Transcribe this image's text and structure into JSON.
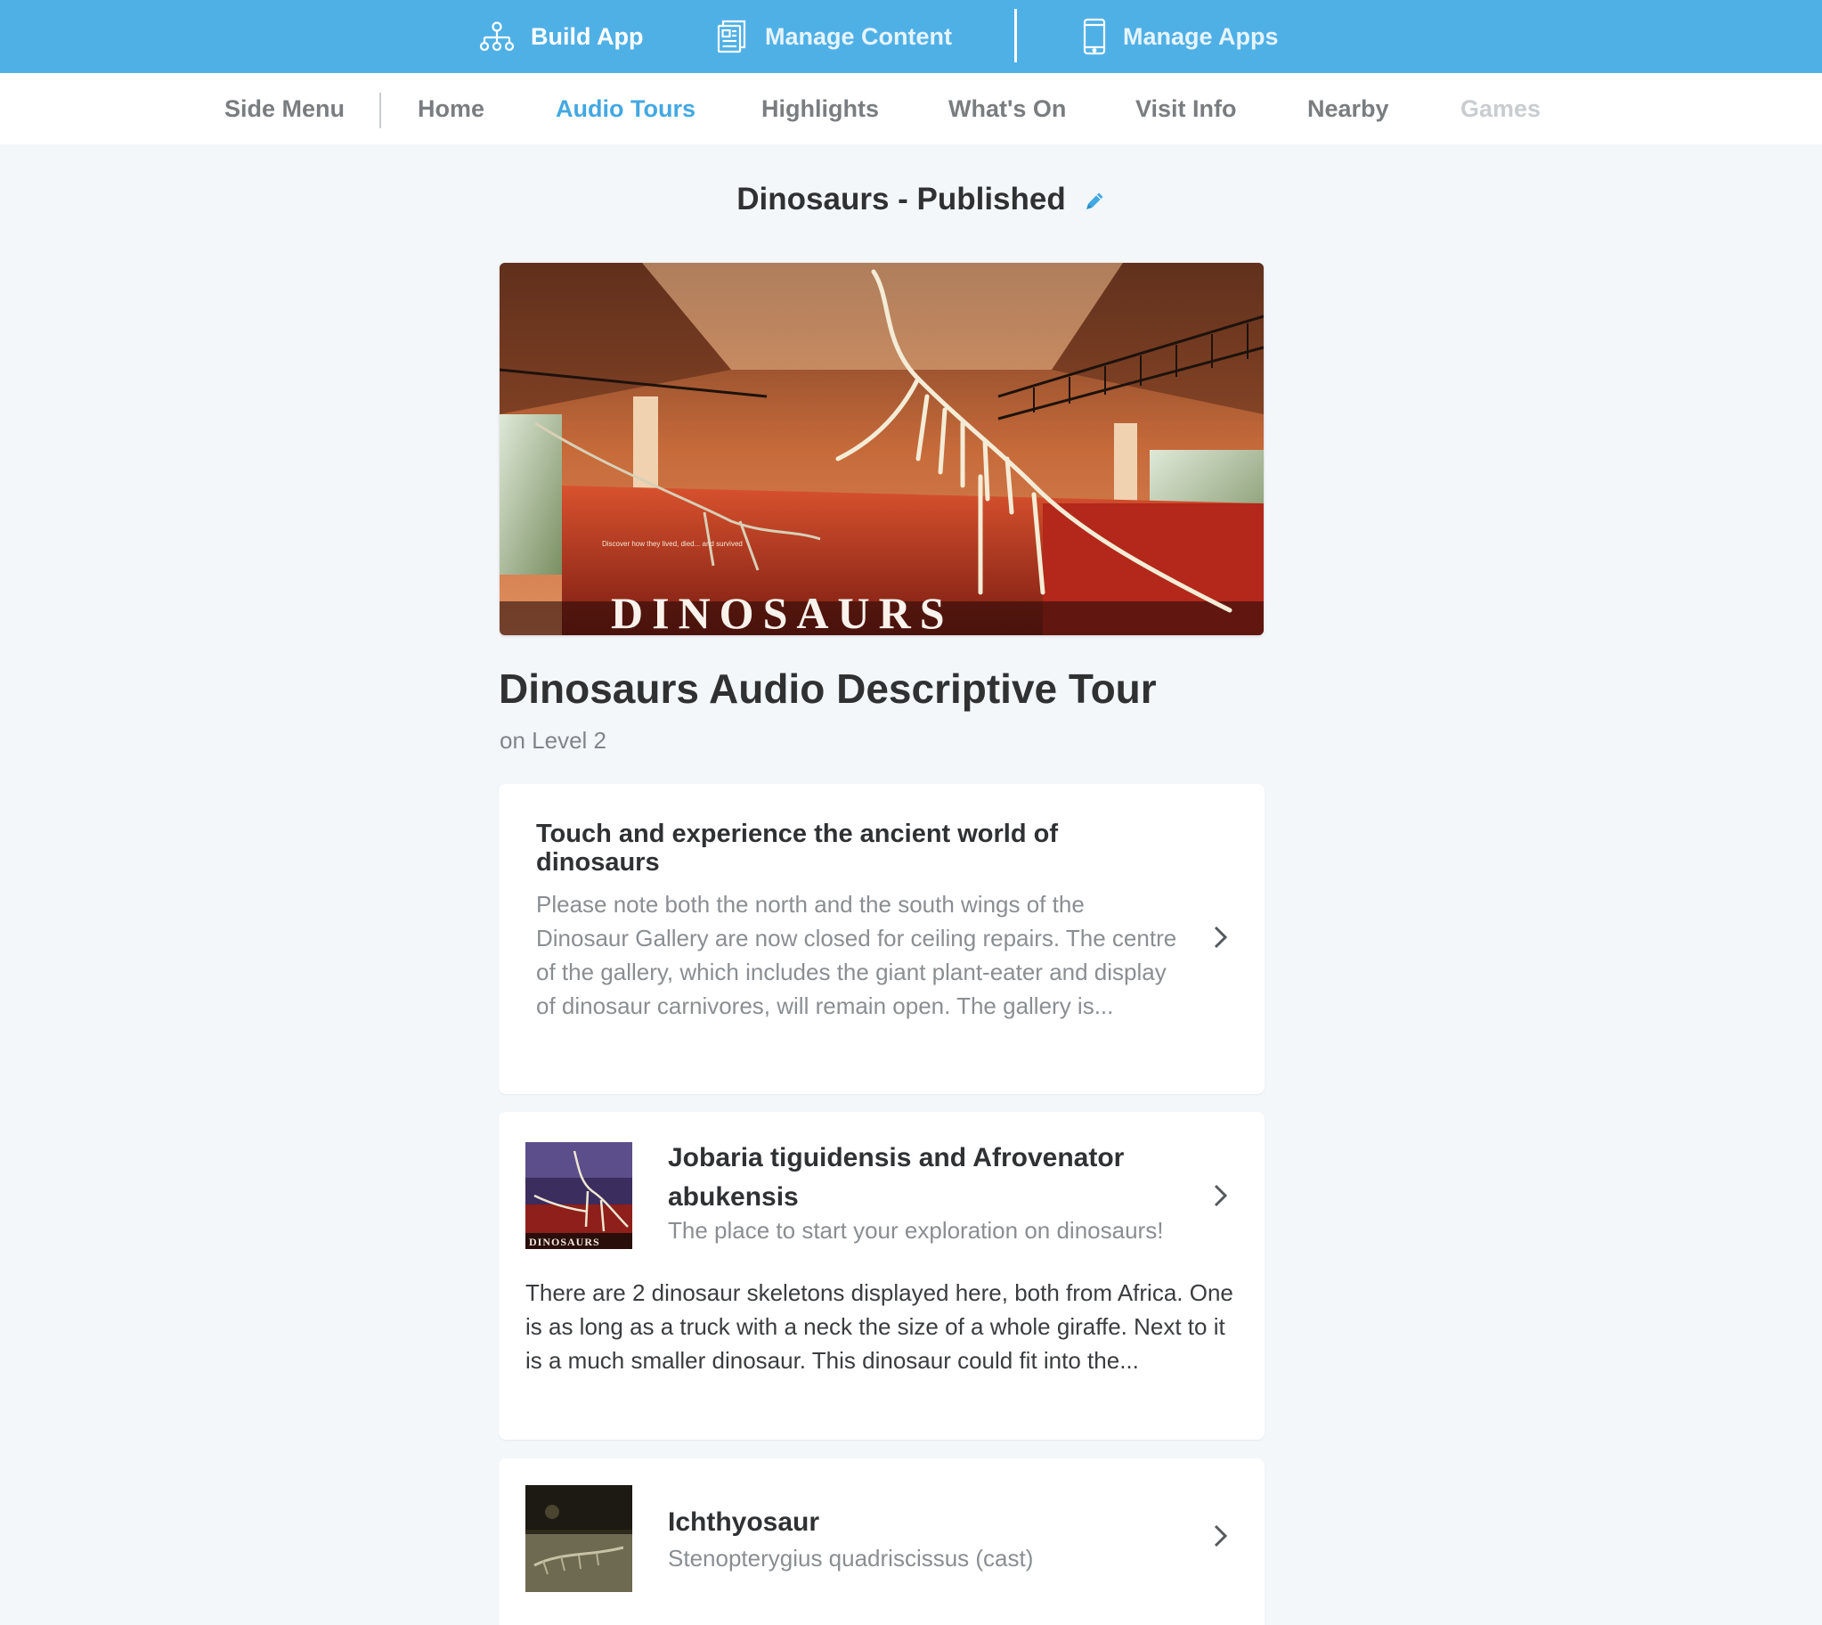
{
  "topnav": {
    "build_app": "Build App",
    "manage_content": "Manage Content",
    "manage_apps": "Manage Apps"
  },
  "subnav": {
    "side_menu": "Side Menu",
    "home": "Home",
    "audio_tours": "Audio Tours",
    "highlights": "Highlights",
    "whats_on": "What's On",
    "visit_info": "Visit Info",
    "nearby": "Nearby",
    "games": "Games"
  },
  "page": {
    "title": "Dinosaurs - Published",
    "tour_title": "Dinosaurs Audio Descriptive Tour",
    "tour_subtitle": "on Level 2",
    "hero_caption": "DINOSAURS",
    "hero_small_text": "Discover how they lived, died... and survived"
  },
  "intro_card": {
    "title": "Touch and experience the ancient world of dinosaurs",
    "body": "Please note both the north and the south wings of the Dinosaur Gallery are now closed for ceiling repairs. The centre of the gallery, which includes the giant plant-eater and display of dinosaur carnivores, will remain open. The gallery is..."
  },
  "stops": [
    {
      "title": "Jobaria tiguidensis and Afrovenator abukensis",
      "subtitle": "The place to start your exploration on dinosaurs!",
      "description": "There are 2 dinosaur skeletons displayed here, both from Africa. One is as long as a truck with a neck the size of a whole giraffe. Next to it is a much smaller dinosaur. This dinosaur could fit into the..."
    },
    {
      "title": "Ichthyosaur",
      "subtitle": "Stenopterygius quadriscissus (cast)"
    }
  ],
  "colors": {
    "topbar": "#4fb0e6",
    "active": "#43a8e2",
    "background": "#f4f7fa"
  }
}
